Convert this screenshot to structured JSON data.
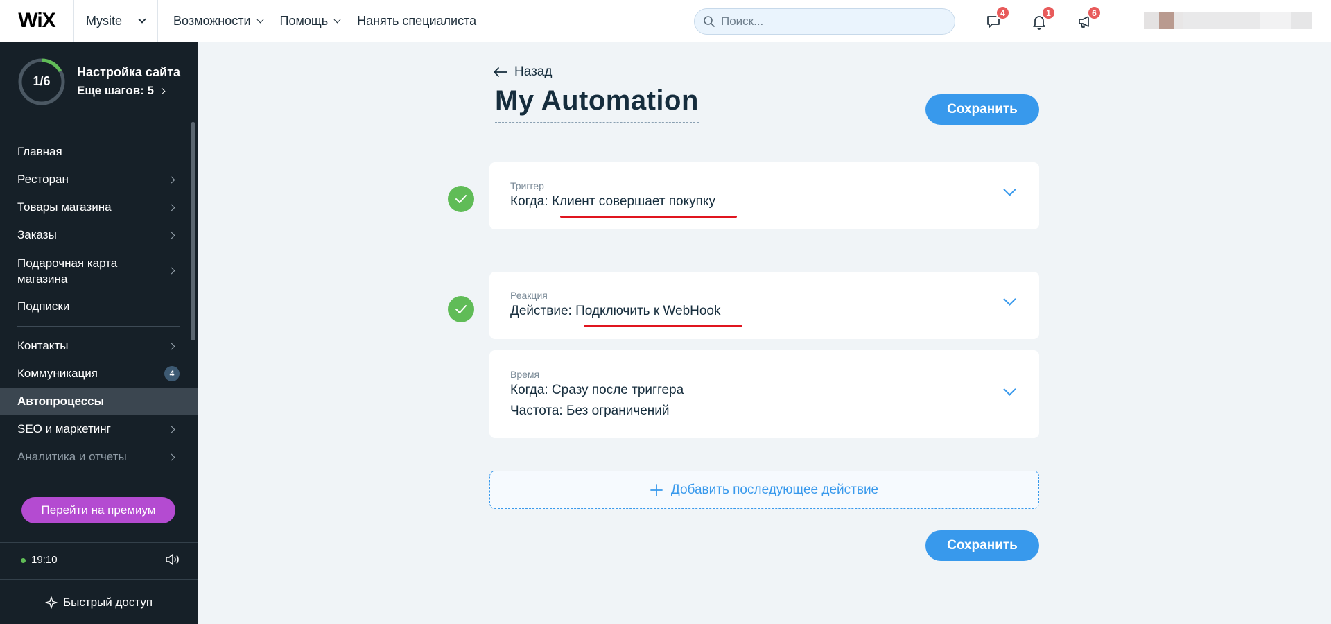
{
  "topbar": {
    "logo": "WiX",
    "site_name": "Mysite",
    "nav": [
      {
        "label": "Возможности"
      },
      {
        "label": "Помощь"
      },
      {
        "label": "Нанять специалиста"
      }
    ],
    "search_placeholder": "Поиск...",
    "icons": [
      {
        "name": "chat-icon",
        "badge": "4"
      },
      {
        "name": "bell-icon",
        "badge": "1"
      },
      {
        "name": "megaphone-icon",
        "badge": "6"
      }
    ]
  },
  "sidebar": {
    "progress": {
      "label": "1/6",
      "fraction": 0.1667
    },
    "setup_title": "Настройка сайта",
    "setup_steps": "Еще шагов: 5",
    "items_top": [
      {
        "label": "Главная",
        "arrow": false
      },
      {
        "label": "Ресторан",
        "arrow": true
      },
      {
        "label": "Товары магазина",
        "arrow": true
      },
      {
        "label": "Заказы",
        "arrow": true
      },
      {
        "label": "Подарочная карта магазина",
        "arrow": true
      },
      {
        "label": "Подписки",
        "arrow": false
      }
    ],
    "items_bottom": [
      {
        "label": "Контакты",
        "arrow": true
      },
      {
        "label": "Коммуникация",
        "badge": "4"
      },
      {
        "label": "Автопроцессы",
        "active": true
      },
      {
        "label": "SEO и маркетинг",
        "arrow": true
      },
      {
        "label": "Аналитика и отчеты",
        "arrow": true,
        "dim": true
      }
    ],
    "premium_label": "Перейти на премиум",
    "time": "19:10",
    "quick_access": "Быстрый доступ"
  },
  "main": {
    "back_label": "Назад",
    "title": "My Automation",
    "save_label": "Сохранить",
    "trigger": {
      "label": "Триггер",
      "prefix": "Когда: ",
      "value": "Клиент совершает покупку"
    },
    "reaction": {
      "label": "Реакция",
      "prefix": "Действие: ",
      "value": "Подключить к WebHook"
    },
    "timing": {
      "label": "Время",
      "line1": "Когда: Сразу после триггера",
      "line2": "Частота: Без ограничений"
    },
    "add_action": "Добавить последующее действие",
    "colors": {
      "accent": "#3899ec",
      "success": "#60bc57",
      "highlight": "#e0151f",
      "premium": "#b44bd1"
    }
  }
}
